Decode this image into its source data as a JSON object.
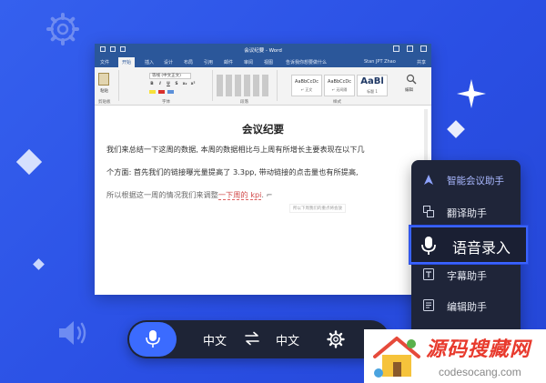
{
  "word": {
    "title": "会议纪要 - Word",
    "tabs": [
      "文件",
      "开始",
      "插入",
      "设计",
      "布局",
      "引用",
      "邮件",
      "审阅",
      "视图",
      "帮助"
    ],
    "active_tab": "开始",
    "search": "告诉我你想要做什么",
    "user": "Stan JPT Zhao",
    "share": "共享",
    "ribbon": {
      "paste_label": "粘贴",
      "font_name": "等线 (中文正文)",
      "clipboard_group": "剪贴板",
      "font_group": "字体",
      "paragraph_group": "段落",
      "styles_group": "样式",
      "edit_group": "编辑",
      "styles": [
        {
          "sample": "AaBbCcDc",
          "name": "↵ 正文"
        },
        {
          "sample": "AaBbCcDc",
          "name": "↵ 无间隔"
        },
        {
          "sample": "AaBl",
          "name": "标题 1"
        }
      ]
    },
    "doc": {
      "title": "会议纪要",
      "line1": "我们来总结一下这周的数据, 本周的数据相比与上周有所增长主要表现在以下几",
      "line2": "个方面: 首先我们的链接曝光量提高了 3.3pp, 带动链接的点击量也有所提高,",
      "line3_a": "所以根据这一周的情况我们来调整",
      "line3_b": "一下周的",
      "line3_c": "kpi",
      "line3_d": ". ⌐",
      "note": "所以下周我们的重点将会放"
    }
  },
  "assistant_panel": {
    "items": [
      {
        "label": "智能会议助手",
        "icon": "logo-icon"
      },
      {
        "label": "翻译助手",
        "icon": "translate-icon"
      },
      {
        "label": "语音录入",
        "icon": "microphone-icon"
      },
      {
        "label": "字幕助手",
        "icon": "subtitle-icon"
      },
      {
        "label": "编辑助手",
        "icon": "edit-icon"
      },
      {
        "label": "",
        "icon": "more-icon"
      }
    ],
    "active": "语音录入"
  },
  "voice_bar": {
    "source_lang": "中文",
    "target_lang": "中文",
    "icons": [
      "microphone-icon",
      "swap-icon",
      "gear-icon"
    ]
  },
  "watermark": {
    "brand": "源码搜藏网",
    "url": "codesocang.com"
  },
  "colors": {
    "background": "#2f58e8",
    "panel": "#1f2539",
    "accent": "#3b6bff",
    "word_blue": "#2b579a"
  }
}
